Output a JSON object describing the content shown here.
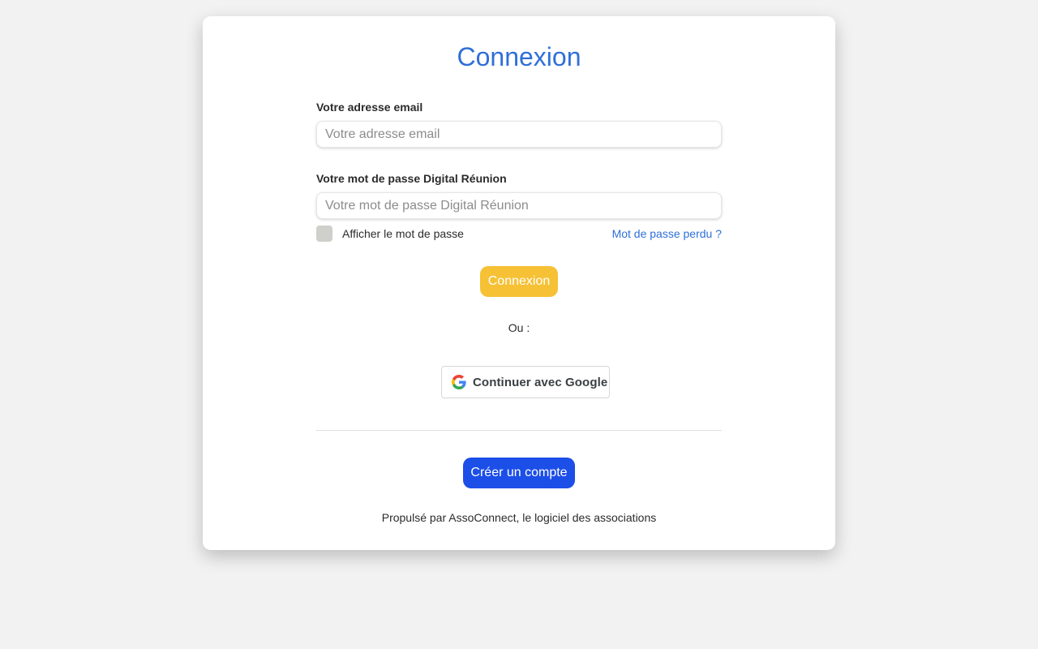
{
  "page": {
    "title": "Connexion"
  },
  "form": {
    "email_label": "Votre adresse email",
    "email_placeholder": "Votre adresse email",
    "email_value": "",
    "password_label": "Votre mot de passe Digital Réunion",
    "password_placeholder": "Votre mot de passe Digital Réunion",
    "password_value": "",
    "show_password_label": "Afficher le mot de passe",
    "show_password_checked": false,
    "forgot_password_link": "Mot de passe perdu ?",
    "login_button": "Connexion"
  },
  "alt_login": {
    "separator_text": "Ou :",
    "google_button": "Continuer avec Google",
    "google_icon": "google-g-icon"
  },
  "signup": {
    "create_account_button": "Créer un compte"
  },
  "footer": {
    "powered_by": "Propulsé par AssoConnect, le logiciel des associations"
  },
  "colors": {
    "title": "#2f6fd8",
    "login_button": "#f6c135",
    "create_button": "#1c4ee8",
    "link": "#2f6fd8",
    "background": "#f2f2f2"
  }
}
